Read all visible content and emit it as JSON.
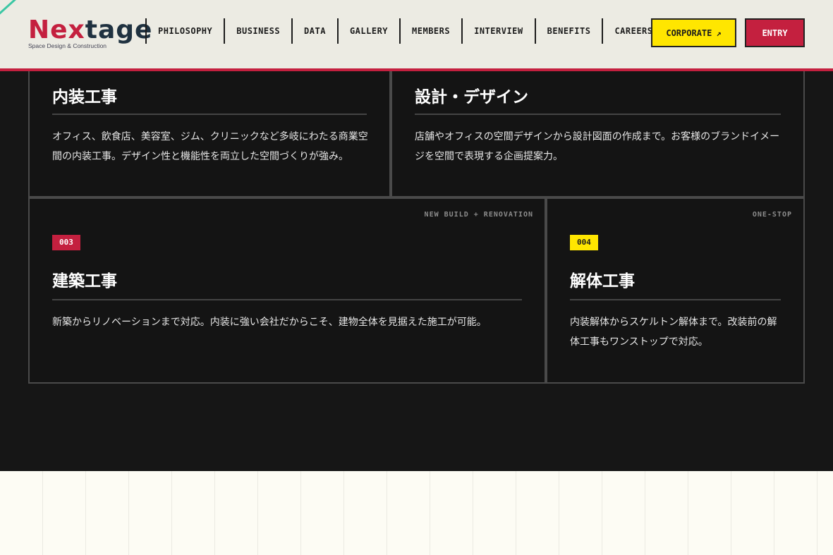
{
  "header": {
    "logo": {
      "part1": "Ne",
      "part2": "x",
      "part3": "tage",
      "tagline": "Space Design & Construction"
    },
    "nav": [
      "PHILOSOPHY",
      "BUSINESS",
      "DATA",
      "GALLERY",
      "MEMBERS",
      "INTERVIEW",
      "BENEFITS",
      "CAREERS"
    ],
    "corporate_label": "CORPORATE",
    "corporate_arrow": "↗",
    "entry_label": "ENTRY"
  },
  "services": [
    {
      "title": "内装工事",
      "desc": "オフィス、飲食店、美容室、ジム、クリニックなど多岐にわたる商業空間の内装工事。デザイン性と機能性を両立した空間づくりが強み。"
    },
    {
      "title": "設計・デザイン",
      "desc": "店舗やオフィスの空間デザインから設計図面の作成まで。お客様のブランドイメージを空間で表現する企画提案力。"
    },
    {
      "number": "003",
      "tag": "NEW BUILD + RENOVATION",
      "title": "建築工事",
      "desc": "新築からリノベーションまで対応。内装に強い会社だからこそ、建物全体を見据えた施工が可能。"
    },
    {
      "number": "004",
      "tag": "ONE-STOP",
      "title": "解体工事",
      "desc": "内装解体からスケルトン解体まで。改装前の解体工事もワンストップで対応。"
    }
  ],
  "colors": {
    "accent_red": "#c4203f",
    "accent_yellow": "#ffe600",
    "dark_bg": "#161616"
  }
}
